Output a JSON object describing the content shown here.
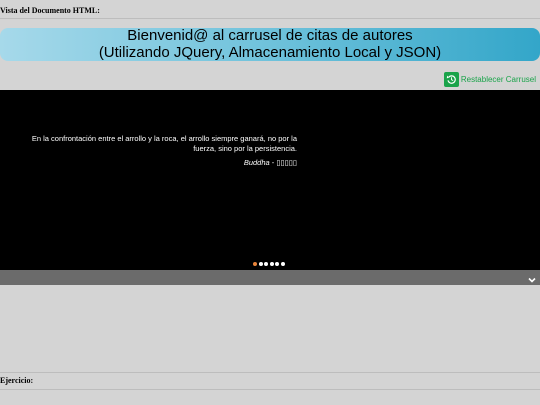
{
  "document_label": "Vista del Documento HTML:",
  "banner": {
    "line1": "Bienvenid@ al carrusel de citas de autores",
    "line2": "(Utilizando JQuery, Almacenamiento Local y JSON)"
  },
  "reset_button": {
    "label": "Restablecer Carrusel",
    "icon": "reset-icon",
    "color": "#1aa34a"
  },
  "carousel": {
    "quote": "En la confrontación entre el arrollo y la roca, el arrollo siempre ganará, no por la fuerza, sino por la persistencia.",
    "author": "Buddha",
    "author_separator": " - ",
    "author_native": "▯▯▯▯▯",
    "slide_count": 6,
    "active_slide": 1,
    "indicator_active_color": "#e8843a"
  },
  "collapse_icon": "chevron-down-icon",
  "exercise_label": "Ejercicio:"
}
